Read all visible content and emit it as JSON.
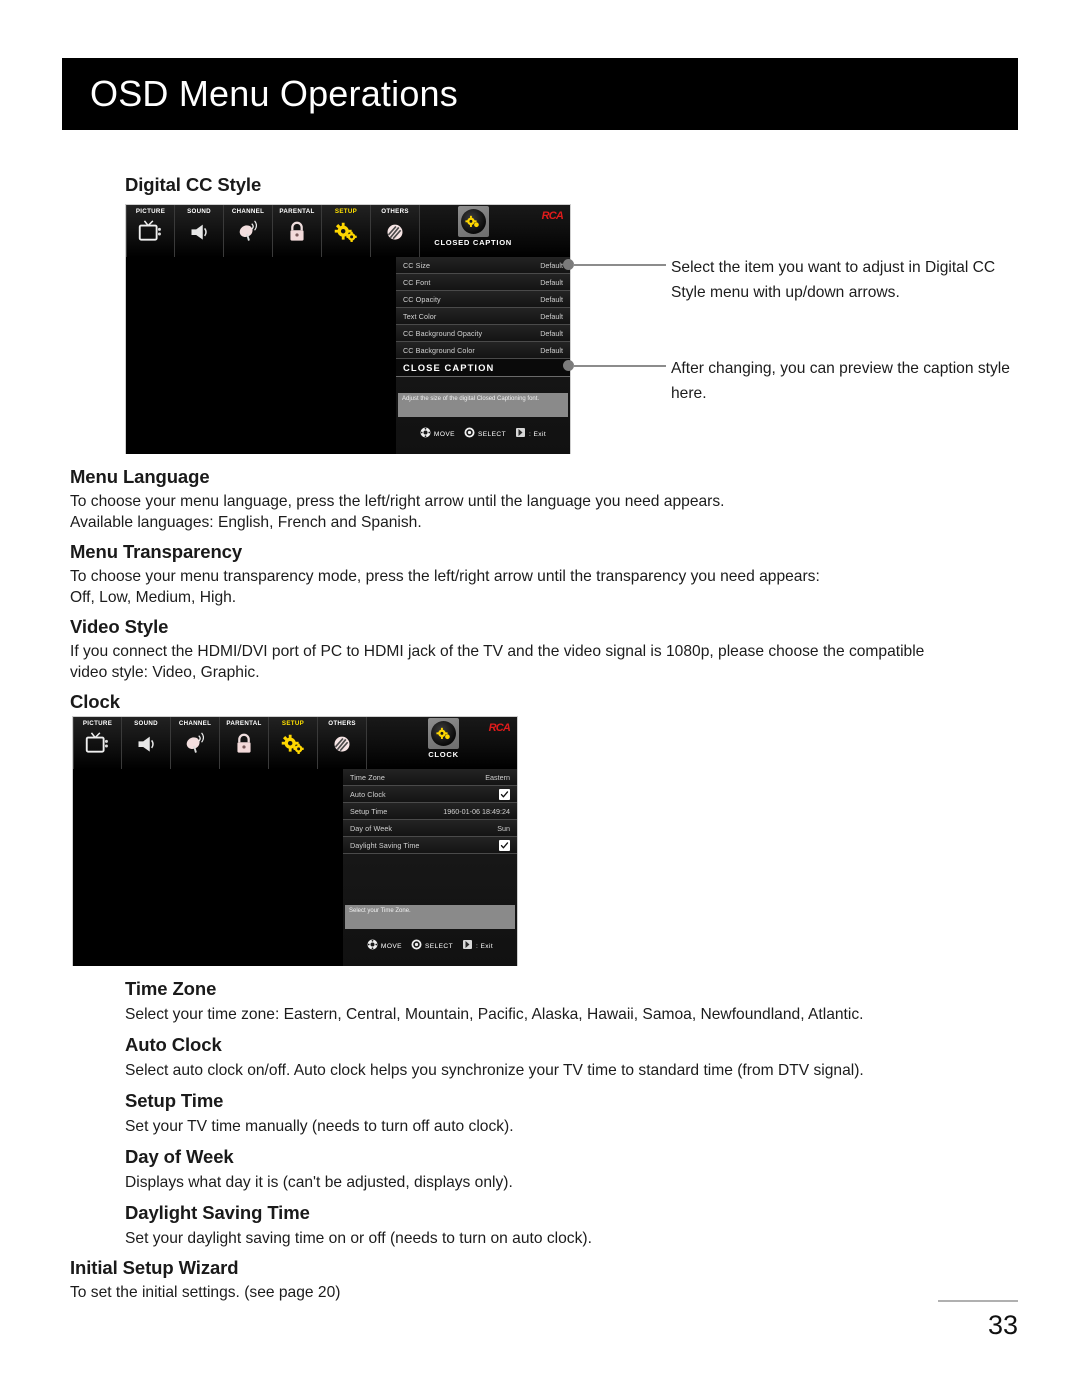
{
  "header": {
    "title": "OSD Menu Operations"
  },
  "sections": {
    "digital_cc_style": {
      "heading": "Digital CC Style"
    },
    "menu_language": {
      "heading": "Menu Language",
      "line1": "To choose your menu language, press the left/right arrow until the language you need appears.",
      "line2": "Available languages: English, French and Spanish."
    },
    "menu_transparency": {
      "heading": "Menu Transparency",
      "line1": "To choose your menu transparency mode, press the left/right arrow until the transparency you need appears:",
      "line2": "Off, Low, Medium, High."
    },
    "video_style": {
      "heading": "Video Style",
      "line1": "If you connect the HDMI/DVI port of PC to HDMI jack of the TV and the video signal is 1080p, please choose the compatible",
      "line2": "video style: Video, Graphic."
    },
    "clock": {
      "heading": "Clock"
    },
    "time_zone": {
      "heading": "Time Zone",
      "line1": "Select your time zone: Eastern, Central, Mountain, Pacific, Alaska, Hawaii, Samoa, Newfoundland, Atlantic."
    },
    "auto_clock": {
      "heading": "Auto Clock",
      "line1": "Select auto clock on/off. Auto clock helps you synchronize your TV time to standard time (from DTV signal)."
    },
    "setup_time": {
      "heading": "Setup Time",
      "line1": "Set your TV time manually (needs to turn off auto clock)."
    },
    "day_of_week": {
      "heading": "Day of Week",
      "line1": "Displays what day it is (can't be adjusted, displays only)."
    },
    "daylight_saving_time": {
      "heading": "Daylight Saving Time",
      "line1": "Set your daylight saving time on or off (needs to turn on auto clock)."
    },
    "initial_setup_wizard": {
      "heading": "Initial Setup Wizard",
      "line1": "To set the initial settings. (see page 20)"
    }
  },
  "osd_tabs": [
    {
      "label": "PICTURE",
      "icon": "tv-icon",
      "active": false
    },
    {
      "label": "SOUND",
      "icon": "speaker-icon",
      "active": false
    },
    {
      "label": "CHANNEL",
      "icon": "satellite-dish-icon",
      "active": false
    },
    {
      "label": "PARENTAL",
      "icon": "lock-icon",
      "active": false
    },
    {
      "label": "SETUP",
      "icon": "gears-icon",
      "active": true
    },
    {
      "label": "OTHERS",
      "icon": "slashed-circle-icon",
      "active": false
    }
  ],
  "osd_cc": {
    "current_label": "CLOSED CAPTION",
    "brand": "RCA",
    "rows": [
      {
        "label": "CC Size",
        "value": "Default"
      },
      {
        "label": "CC Font",
        "value": "Default"
      },
      {
        "label": "CC Opacity",
        "value": "Default"
      },
      {
        "label": "Text Color",
        "value": "Default"
      },
      {
        "label": "CC Background Opacity",
        "value": "Default"
      },
      {
        "label": "CC Background Color",
        "value": "Default"
      }
    ],
    "preview_label": "CLOSE CAPTION",
    "hint": "Adjust the size of the digital Closed Captioning font.",
    "nav": [
      {
        "label": "MOVE",
        "icon": "dpad-icon"
      },
      {
        "label": "SELECT",
        "icon": "ok-button-icon"
      },
      {
        "label": ": Exit",
        "icon": "exit-icon"
      }
    ]
  },
  "osd_clock": {
    "current_label": "CLOCK",
    "brand": "RCA",
    "rows": [
      {
        "label": "Time Zone",
        "value": "Eastern",
        "type": "text"
      },
      {
        "label": "Auto Clock",
        "value": "",
        "type": "checkbox"
      },
      {
        "label": "Setup Time",
        "value": "1960-01-06 18:49:24",
        "type": "text"
      },
      {
        "label": "Day of Week",
        "value": "Sun",
        "type": "text"
      },
      {
        "label": "Daylight Saving Time",
        "value": "",
        "type": "checkbox"
      }
    ],
    "hint": "Select your Time Zone.",
    "nav": [
      {
        "label": "MOVE",
        "icon": "dpad-icon"
      },
      {
        "label": "SELECT",
        "icon": "ok-button-icon"
      },
      {
        "label": ": Exit",
        "icon": "exit-icon"
      }
    ]
  },
  "callouts": [
    {
      "line1": "Select the item you want to adjust in Digital CC",
      "line2": "Style menu with up/down arrows."
    },
    {
      "line1": "After changing, you can preview the caption style",
      "line2": "here."
    }
  ],
  "footer": {
    "page_number": "33"
  }
}
